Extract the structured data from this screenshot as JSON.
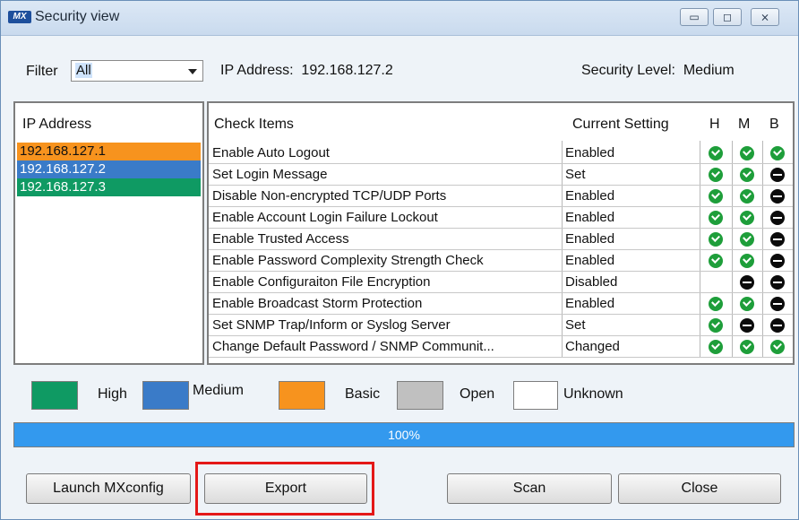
{
  "window": {
    "app_icon_text": "MX",
    "title": "Security view",
    "controls": {
      "minimize": "▭",
      "maximize": "◻",
      "close": "⨯"
    }
  },
  "filter": {
    "label": "Filter",
    "selected": "All",
    "ip_address_label": "IP Address:",
    "ip_address_value": "192.168.127.2",
    "security_level_label": "Security Level:",
    "security_level_value": "Medium"
  },
  "ip_list": {
    "header": "IP Address",
    "items": [
      {
        "ip": "192.168.127.1",
        "level": "Basic"
      },
      {
        "ip": "192.168.127.2",
        "level": "Medium"
      },
      {
        "ip": "192.168.127.3",
        "level": "High"
      }
    ]
  },
  "checks": {
    "headers": {
      "item": "Check Items",
      "setting": "Current Setting",
      "h": "H",
      "m": "M",
      "b": "B"
    },
    "rows": [
      {
        "item": "Enable Auto Logout",
        "setting": "Enabled",
        "h": "ok",
        "m": "ok",
        "b": "ok"
      },
      {
        "item": "Set Login Message",
        "setting": "Set",
        "h": "ok",
        "m": "ok",
        "b": "no"
      },
      {
        "item": "Disable Non-encrypted TCP/UDP Ports",
        "setting": "Enabled",
        "h": "ok",
        "m": "ok",
        "b": "no"
      },
      {
        "item": "Enable Account Login Failure Lockout",
        "setting": "Enabled",
        "h": "ok",
        "m": "ok",
        "b": "no"
      },
      {
        "item": "Enable Trusted Access",
        "setting": "Enabled",
        "h": "ok",
        "m": "ok",
        "b": "no"
      },
      {
        "item": "Enable Password Complexity Strength Check",
        "setting": "Enabled",
        "h": "ok",
        "m": "ok",
        "b": "no"
      },
      {
        "item": "Enable Configuraiton File Encryption",
        "setting": "Disabled",
        "h": "",
        "m": "no",
        "b": "no"
      },
      {
        "item": "Enable Broadcast Storm Protection",
        "setting": "Enabled",
        "h": "ok",
        "m": "ok",
        "b": "no"
      },
      {
        "item": "Set SNMP Trap/Inform or Syslog Server",
        "setting": "Set",
        "h": "ok",
        "m": "no",
        "b": "no"
      },
      {
        "item": "Change Default Password / SNMP Communit...",
        "setting": "Changed",
        "h": "ok",
        "m": "ok",
        "b": "ok"
      }
    ]
  },
  "legend": [
    {
      "label": "High",
      "color": "#0f9a63"
    },
    {
      "label": "Medium",
      "color": "#3a7bc8"
    },
    {
      "label": "Basic",
      "color": "#f7931e"
    },
    {
      "label": "Open",
      "color": "#c0c0c0"
    },
    {
      "label": "Unknown",
      "color": "#ffffff"
    }
  ],
  "progress": {
    "text": "100%",
    "fraction": 1.0
  },
  "buttons": {
    "launch": "Launch MXconfig",
    "export": "Export",
    "scan": "Scan",
    "close": "Close"
  },
  "colors": {
    "high": "#0f9a63",
    "medium": "#3a7bc8",
    "basic": "#f7931e",
    "highlight": "#e41818"
  }
}
